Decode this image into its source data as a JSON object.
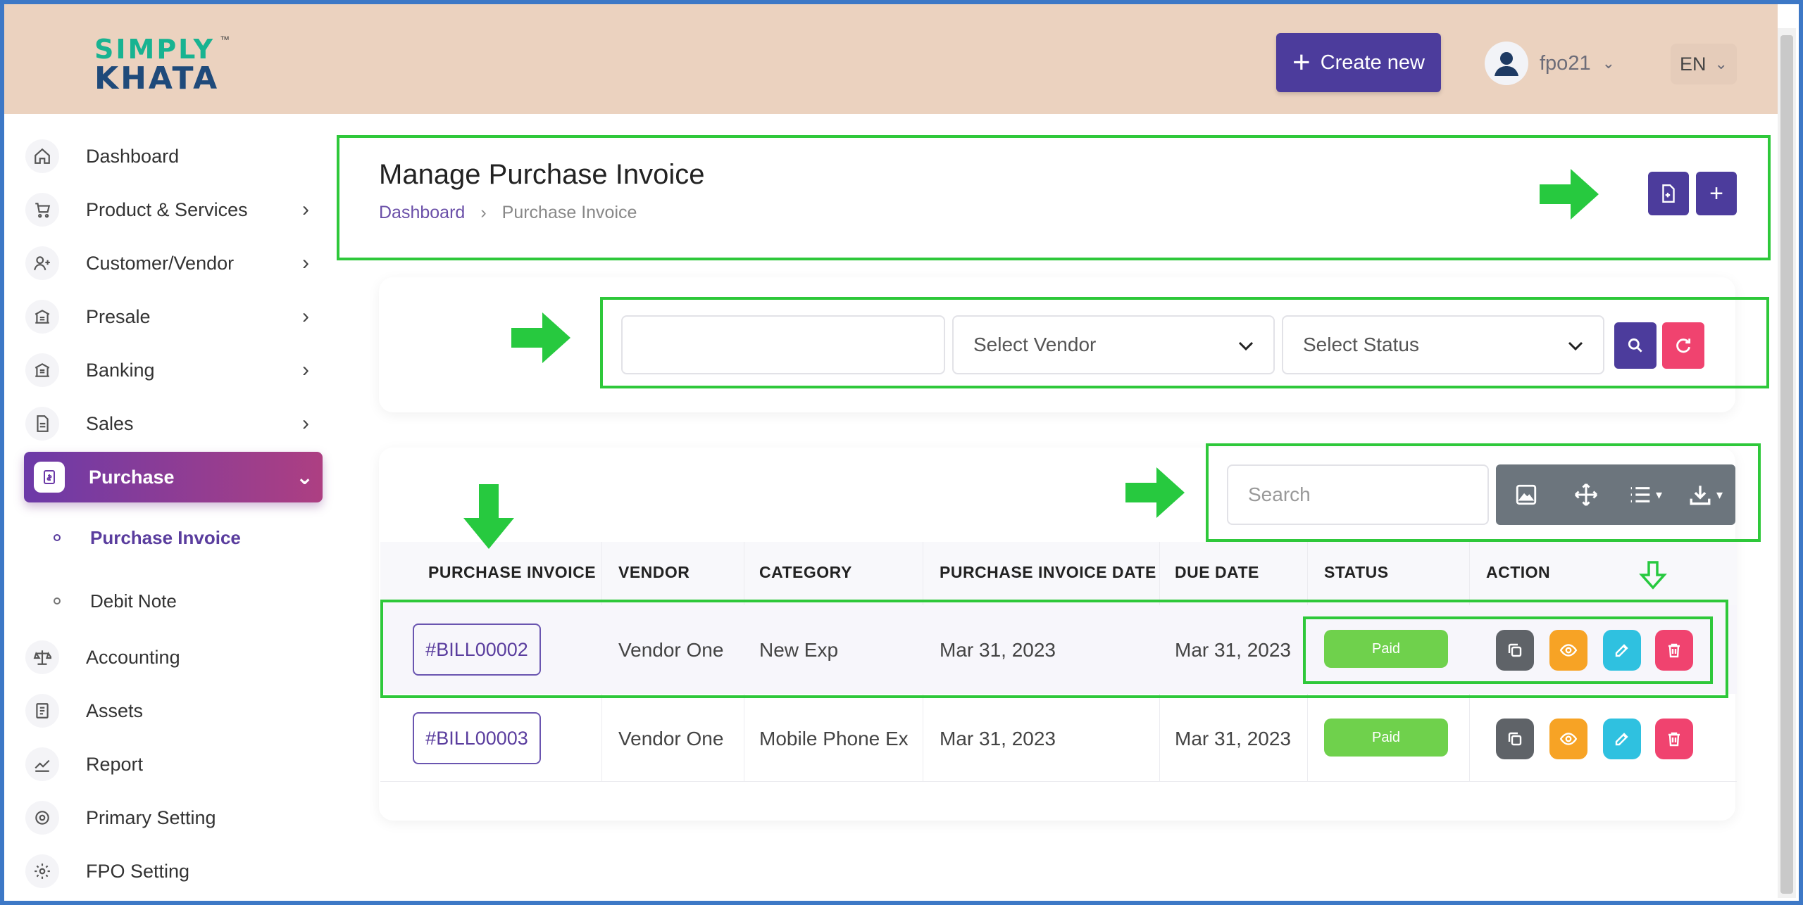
{
  "brand": {
    "line1": "SIMPLY",
    "line2": "KHATA",
    "tm": "™"
  },
  "header": {
    "create_label": "Create new",
    "user_name": "fpo21",
    "language": "EN"
  },
  "sidebar": {
    "items": [
      {
        "label": "Dashboard",
        "icon": "home-icon"
      },
      {
        "label": "Product & Services",
        "icon": "cart-icon"
      },
      {
        "label": "Customer/Vendor",
        "icon": "user-plus-icon"
      },
      {
        "label": "Presale",
        "icon": "building-icon"
      },
      {
        "label": "Banking",
        "icon": "bank-icon"
      },
      {
        "label": "Sales",
        "icon": "document-icon"
      },
      {
        "label": "Purchase",
        "icon": "invoice-icon"
      },
      {
        "label": "Accounting",
        "icon": "scale-icon"
      },
      {
        "label": "Assets",
        "icon": "clipboard-icon"
      },
      {
        "label": "Report",
        "icon": "chart-icon"
      },
      {
        "label": "Primary Setting",
        "icon": "settings-icon"
      },
      {
        "label": "FPO Setting",
        "icon": "gear-icon"
      }
    ],
    "sub_items": [
      {
        "label": "Purchase Invoice"
      },
      {
        "label": "Debit Note"
      }
    ]
  },
  "page": {
    "title": "Manage Purchase Invoice",
    "breadcrumb": [
      "Dashboard",
      "Purchase Invoice"
    ]
  },
  "filters": {
    "date_value": "",
    "vendor_placeholder": "Select Vendor",
    "status_placeholder": "Select Status"
  },
  "table": {
    "search_placeholder": "Search",
    "columns": [
      "PURCHASE INVOICE",
      "VENDOR",
      "CATEGORY",
      "PURCHASE INVOICE DATE",
      "DUE DATE",
      "STATUS",
      "ACTION"
    ],
    "rows": [
      {
        "invoice": "#BILL00002",
        "vendor": "Vendor One",
        "category": "New Exp",
        "invoice_date": "Mar 31, 2023",
        "due_date": "Mar 31, 2023",
        "status": "Paid"
      },
      {
        "invoice": "#BILL00003",
        "vendor": "Vendor One",
        "category": "Mobile Phone Ex",
        "invoice_date": "Mar 31, 2023",
        "due_date": "Mar 31, 2023",
        "status": "Paid"
      }
    ]
  },
  "colors": {
    "primary": "#4c3c9c",
    "active_gradient_start": "#6c3aa8",
    "active_gradient_end": "#ad3f82",
    "paid": "#6fd14c",
    "copy": "#5f6368",
    "view": "#f7a325",
    "edit": "#2fc1e0",
    "delete": "#f0436f",
    "annotation": "#2ec83a"
  }
}
